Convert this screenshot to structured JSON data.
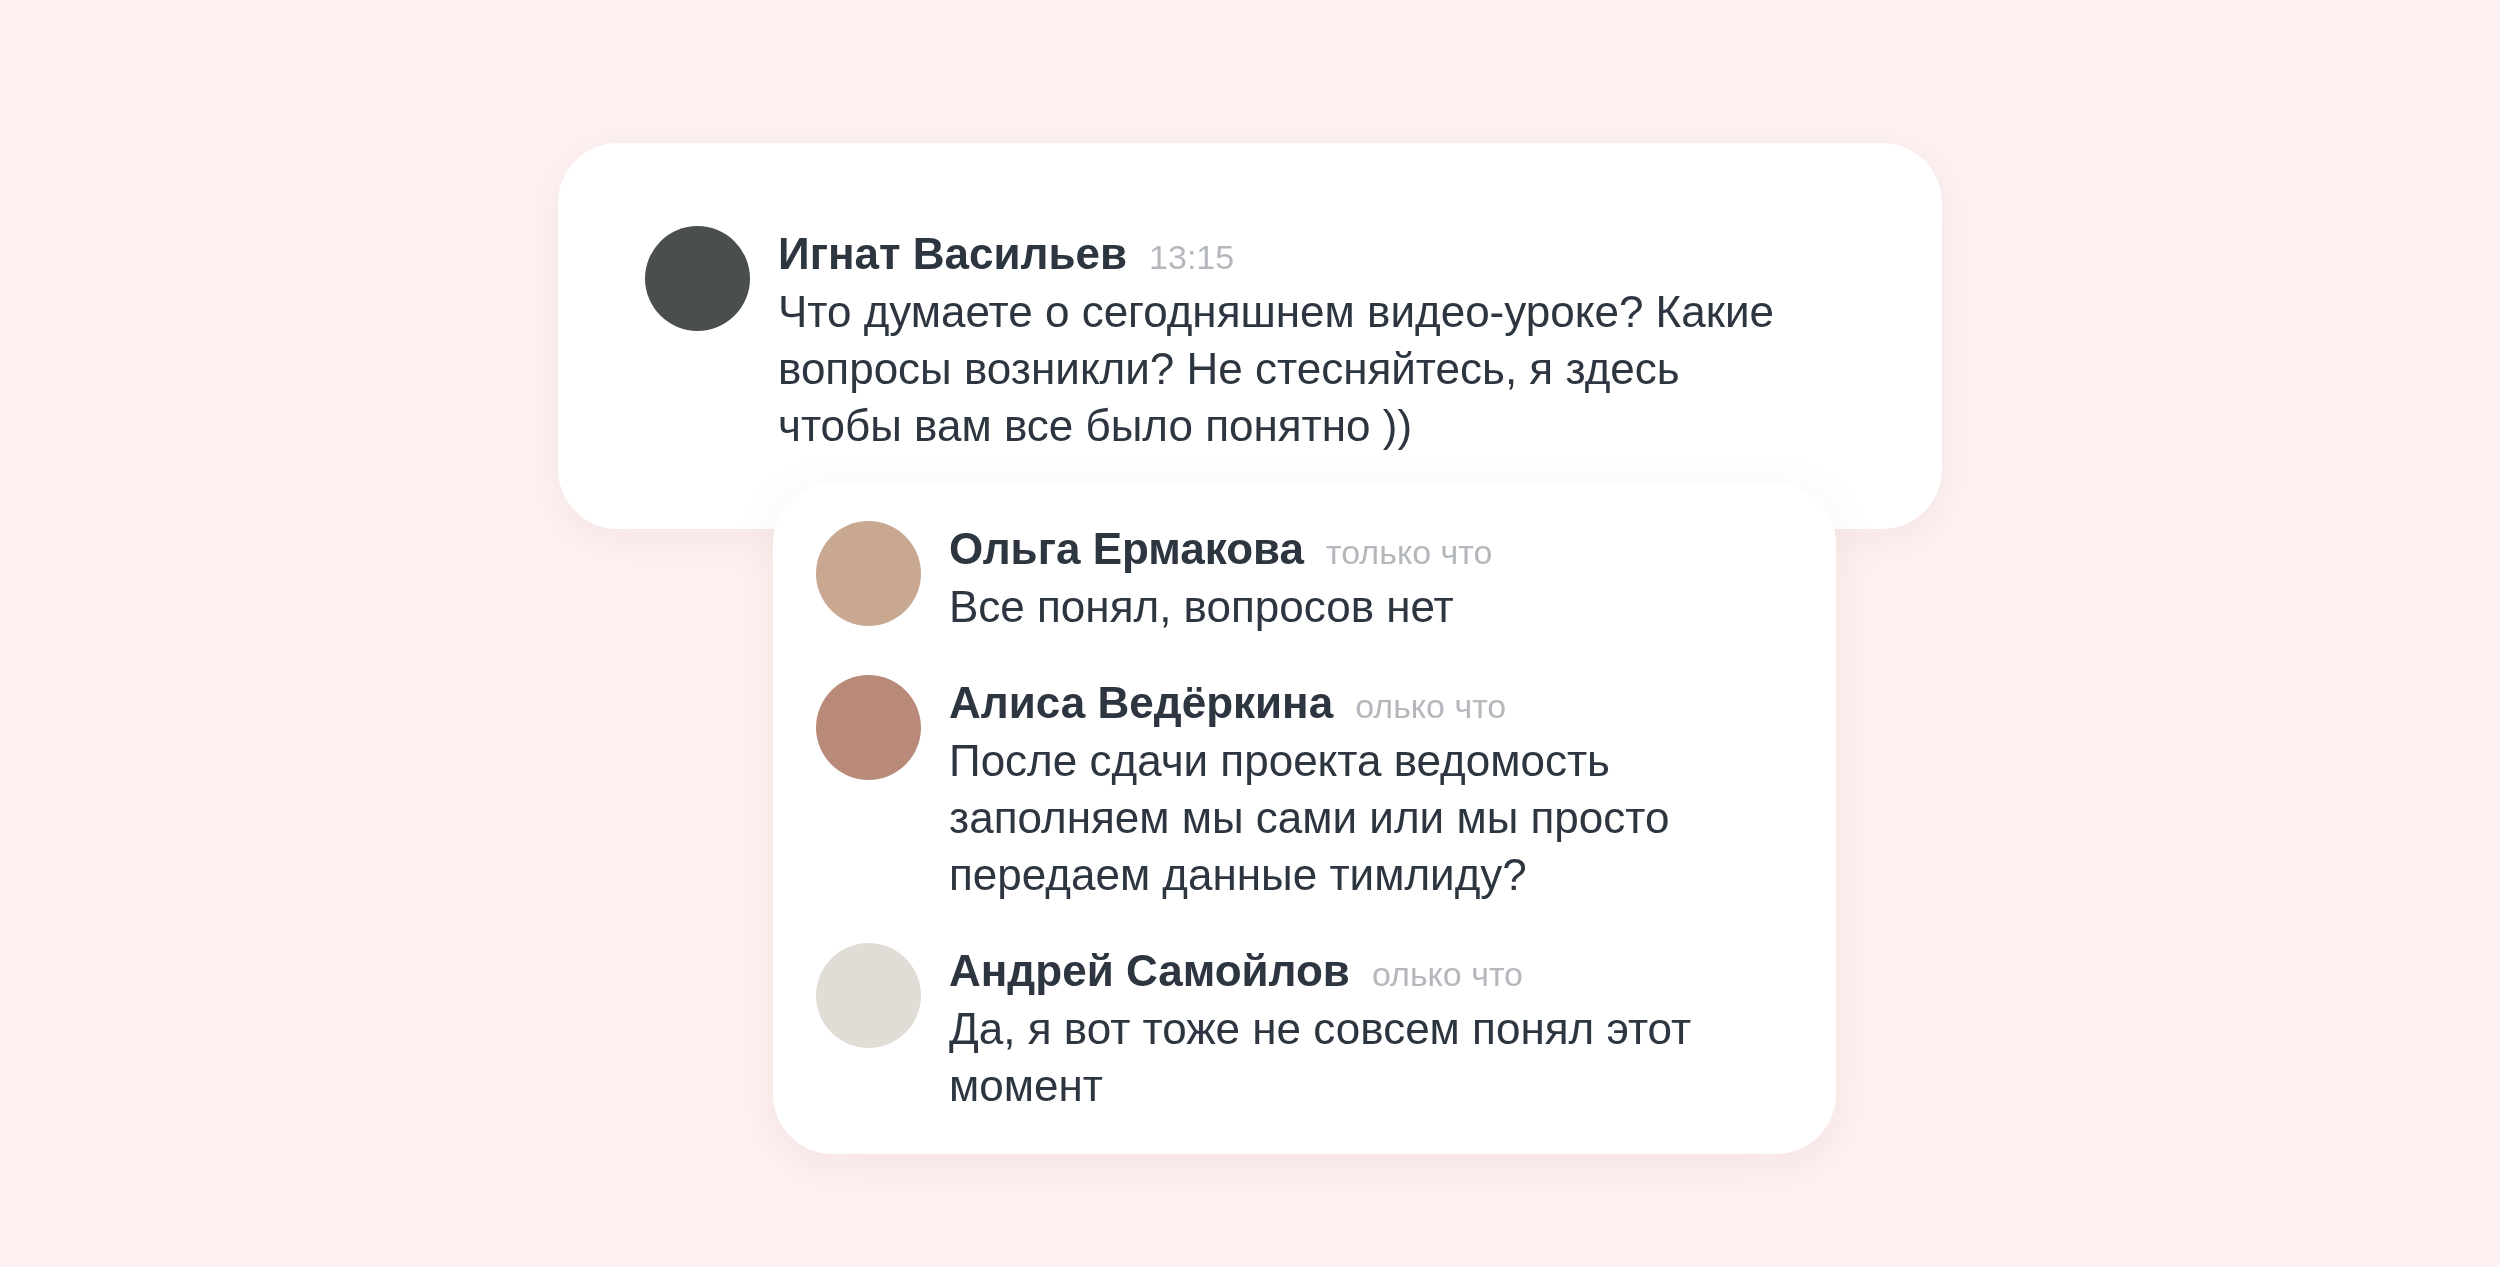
{
  "post": {
    "author": "Игнат Васильев",
    "time": "13:15",
    "text": "Что думаете о сегодняшнем видео-уроке? Какие вопросы возникли? Не стесняйтесь, я здесь чтобы вам все было понятно ))"
  },
  "replies": [
    {
      "author": "Ольга Ермакова",
      "time": "только что",
      "text": "Все понял, вопросов нет"
    },
    {
      "author": "Алиса Ведёркина",
      "time": "олько что",
      "text": "После сдачи проекта ведомость заполняем мы сами или мы просто передаем данные тимлиду?"
    },
    {
      "author": "Андрей Самойлов",
      "time": "олько что",
      "text": "Да, я вот тоже не совсем понял этот момент"
    }
  ]
}
